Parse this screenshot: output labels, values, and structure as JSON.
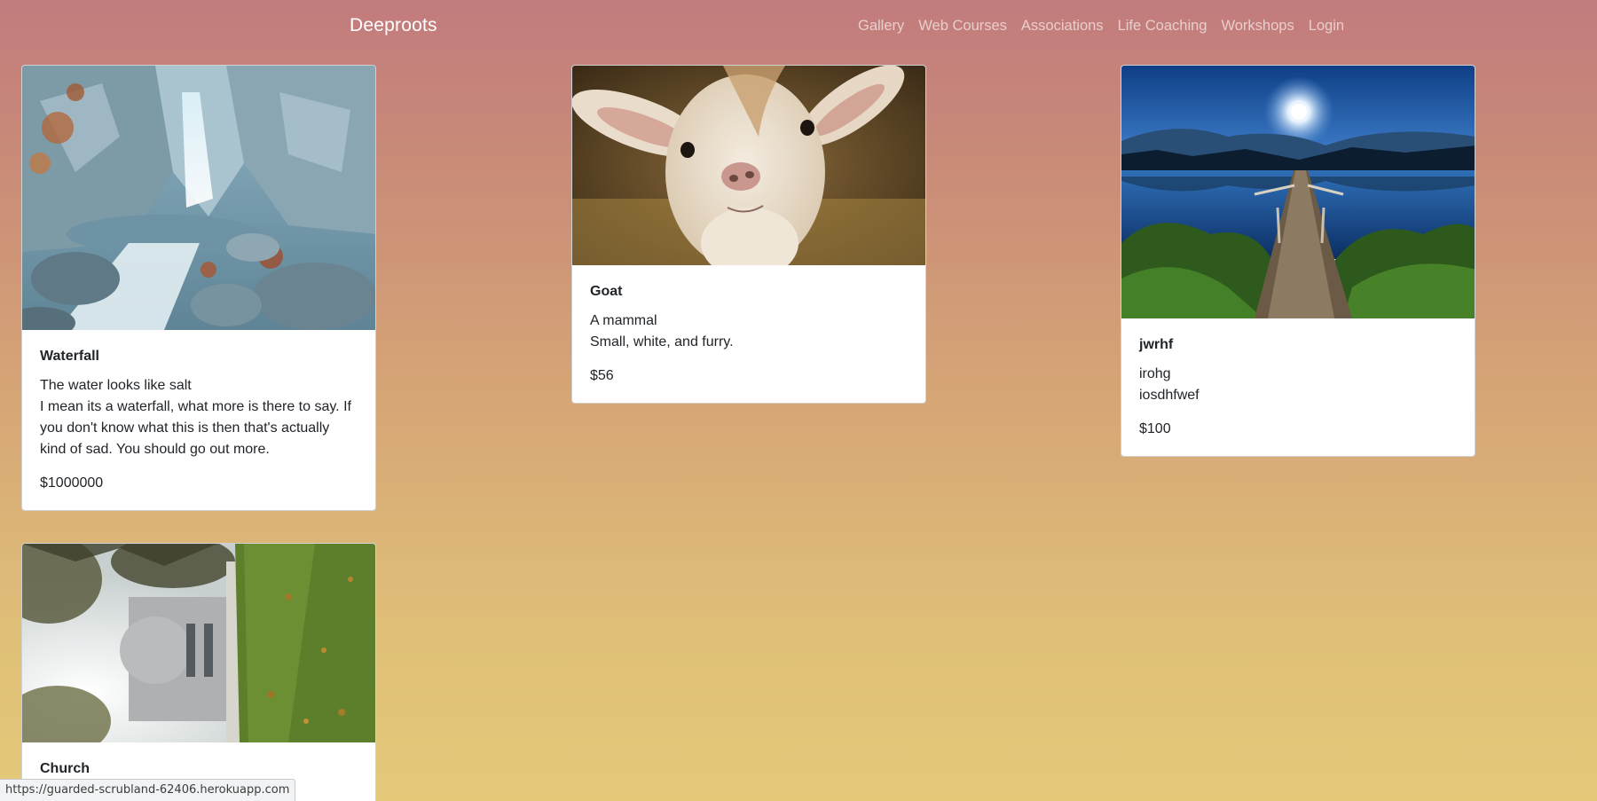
{
  "navbar": {
    "brand": "Deeproots",
    "links": [
      {
        "label": "Gallery"
      },
      {
        "label": "Web Courses"
      },
      {
        "label": "Associations"
      },
      {
        "label": "Life Coaching"
      },
      {
        "label": "Workshops"
      },
      {
        "label": "Login"
      }
    ]
  },
  "cards": [
    {
      "image": "waterfall-photo",
      "title": "Waterfall",
      "text_line1": "The water looks like salt",
      "text_line2": "I mean its a waterfall, what more is there to say. If you don't know what this is then that's actually kind of sad. You should go out more.",
      "price": "$1000000"
    },
    {
      "image": "goat-photo",
      "title": "Goat",
      "text_line1": "A mammal",
      "text_line2": "Small, white, and furry.",
      "price": "$56"
    },
    {
      "image": "lake-dock-photo",
      "title": "jwrhf",
      "text_line1": "irohg",
      "text_line2": "iosdhfwef",
      "price": "$100"
    },
    {
      "image": "church-photo",
      "title": "Church"
    }
  ],
  "status_bar": {
    "url": "https://guarded-scrubland-62406.herokuapp.com"
  },
  "colors": {
    "gradient_top": "#c27b7d",
    "gradient_bottom": "#e4c979",
    "nav_link": "#f0d6d6",
    "card_bg": "#ffffff"
  }
}
